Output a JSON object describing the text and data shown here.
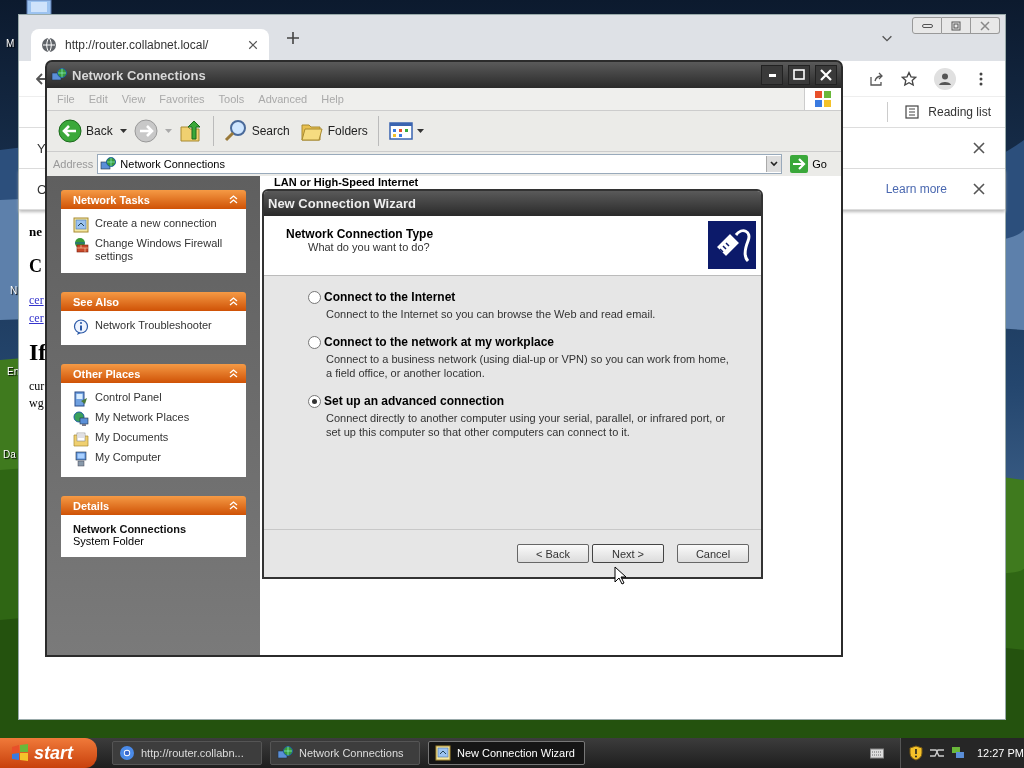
{
  "desktop": {
    "icon_labels": [
      "M",
      "N",
      "En",
      "Da"
    ]
  },
  "browser": {
    "tab_title": "http://router.collabnet.local/",
    "reading_list": "Reading list",
    "info_bars": [
      {
        "text": "Y"
      },
      {
        "text": "C",
        "link": "Learn more"
      }
    ],
    "page": [
      {
        "kind": "bold",
        "text": "ne"
      },
      {
        "kind": "heading",
        "text": "C"
      },
      {
        "kind": "link",
        "text": "cer"
      },
      {
        "kind": "link",
        "text": "cer"
      },
      {
        "kind": "title",
        "text": "If"
      },
      {
        "kind": "plain",
        "text": "cur"
      },
      {
        "kind": "plain",
        "text": "wg"
      }
    ]
  },
  "explorer": {
    "title": "Network Connections",
    "menu": [
      "File",
      "Edit",
      "View",
      "Favorites",
      "Tools",
      "Advanced",
      "Help"
    ],
    "toolbar": [
      {
        "kind": "back",
        "label": "Back"
      },
      {
        "kind": "forward"
      },
      {
        "kind": "up"
      },
      {
        "kind": "search",
        "label": "Search"
      },
      {
        "kind": "folders",
        "label": "Folders"
      },
      {
        "kind": "views"
      }
    ],
    "address": {
      "label": "Address",
      "value": "Network Connections",
      "go": "Go"
    },
    "task_panes": [
      {
        "title": "Network Tasks",
        "items": [
          {
            "kind": "new-connection",
            "label": "Create a new connection"
          },
          {
            "kind": "firewall",
            "label": "Change Windows Firewall settings"
          }
        ]
      },
      {
        "title": "See Also",
        "items": [
          {
            "kind": "info",
            "label": "Network Troubleshooter"
          }
        ]
      },
      {
        "title": "Other Places",
        "items": [
          {
            "kind": "control-panel",
            "label": "Control Panel"
          },
          {
            "kind": "network-places",
            "label": "My Network Places"
          },
          {
            "kind": "documents",
            "label": "My Documents"
          },
          {
            "kind": "computer",
            "label": "My Computer"
          }
        ]
      }
    ],
    "details": {
      "title": "Details",
      "name": "Network Connections",
      "type": "System Folder"
    },
    "content_heading": "LAN or High-Speed Internet"
  },
  "wizard": {
    "title": "New Connection Wizard",
    "heading": "Network Connection Type",
    "subheading": "What do you want to do?",
    "options": [
      {
        "label": "Connect to the Internet",
        "description": "Connect to the Internet so you can browse the Web and read email.",
        "selected": false
      },
      {
        "label": "Connect to the network at my workplace",
        "description": "Connect to a business network (using dial-up or VPN) so you can work from home, a field office, or another location.",
        "selected": false
      },
      {
        "label": "Set up an advanced connection",
        "description": "Connect directly to another computer using your serial, parallel, or infrared port, or set up this computer so that other computers can connect to it.",
        "selected": true
      }
    ],
    "buttons": [
      {
        "kind": "back",
        "label": "< Back"
      },
      {
        "kind": "next",
        "label": "Next >"
      },
      {
        "kind": "cancel",
        "label": "Cancel"
      }
    ]
  },
  "taskbar": {
    "start": "start",
    "tasks": [
      {
        "kind": "browser",
        "label": "http://router.collabn...",
        "selected": false
      },
      {
        "kind": "network",
        "label": "Network Connections",
        "selected": false
      },
      {
        "kind": "wizard",
        "label": "New Connection Wizard",
        "selected": true
      }
    ],
    "clock": "12:27 PM"
  }
}
